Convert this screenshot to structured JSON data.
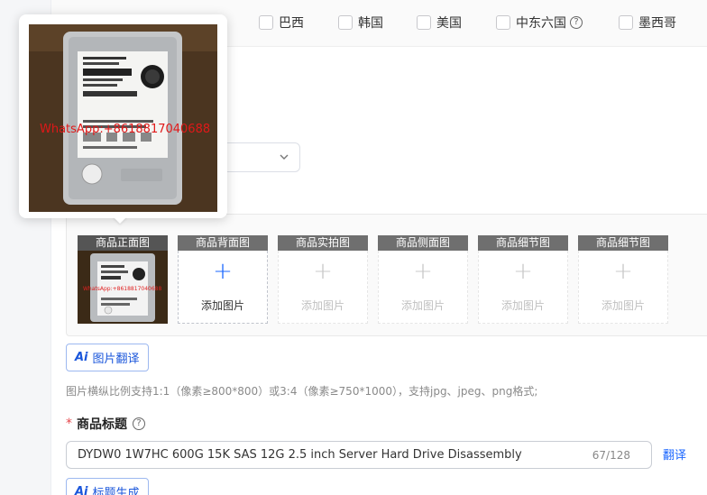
{
  "countries": [
    {
      "label": "巴西"
    },
    {
      "label": "韩国"
    },
    {
      "label": "美国"
    },
    {
      "label": "中东六国"
    },
    {
      "label": "墨西哥"
    }
  ],
  "preview": {
    "watermark": "WhatsApp:+8618817040688"
  },
  "image_slots": [
    {
      "label": "商品正面图",
      "state": "filled",
      "add_label": ""
    },
    {
      "label": "商品背面图",
      "state": "active",
      "add_label": "添加图片"
    },
    {
      "label": "商品实拍图",
      "state": "disabled",
      "add_label": "添加图片"
    },
    {
      "label": "商品侧面图",
      "state": "disabled",
      "add_label": "添加图片"
    },
    {
      "label": "商品细节图",
      "state": "disabled",
      "add_label": "添加图片"
    },
    {
      "label": "商品细节图",
      "state": "disabled",
      "add_label": "添加图片"
    }
  ],
  "image_translate_label": "图片翻译",
  "hint_text": "图片横纵比例支持1:1（像素≥800*800）或3:4（像素≥750*1000），支持jpg、jpeg、png格式;",
  "title_field": {
    "label": "商品标题",
    "value": "DYDW0 1W7HC 600G 15K SAS 12G 2.5 inch Server Hard Drive Disassembly",
    "count": "67/128",
    "translate_link": "翻译",
    "generate_label": "标题生成"
  },
  "colors": {
    "accent": "#1a66ff",
    "required": "#e5484d"
  }
}
